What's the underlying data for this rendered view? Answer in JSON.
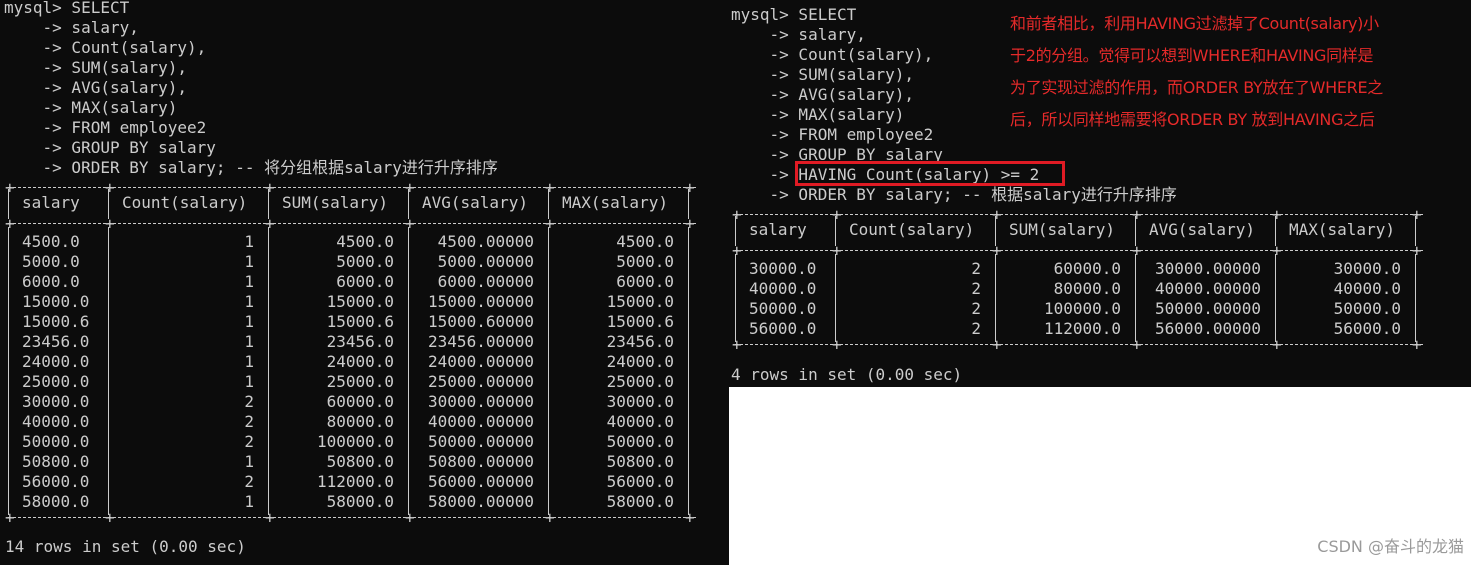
{
  "left": {
    "query": [
      "mysql> SELECT",
      "    -> salary,",
      "    -> Count(salary),",
      "    -> SUM(salary),",
      "    -> AVG(salary),",
      "    -> MAX(salary)",
      "    -> FROM employee2",
      "    -> GROUP BY salary",
      "    -> ORDER BY salary; -- 将分组根据salary进行升序排序"
    ],
    "headers": [
      "salary",
      "Count(salary)",
      "SUM(salary)",
      "AVG(salary)",
      "MAX(salary)"
    ],
    "rows": [
      [
        "4500.0",
        "1",
        "4500.0",
        "4500.00000",
        "4500.0"
      ],
      [
        "5000.0",
        "1",
        "5000.0",
        "5000.00000",
        "5000.0"
      ],
      [
        "6000.0",
        "1",
        "6000.0",
        "6000.00000",
        "6000.0"
      ],
      [
        "15000.0",
        "1",
        "15000.0",
        "15000.00000",
        "15000.0"
      ],
      [
        "15000.6",
        "1",
        "15000.6",
        "15000.60000",
        "15000.6"
      ],
      [
        "23456.0",
        "1",
        "23456.0",
        "23456.00000",
        "23456.0"
      ],
      [
        "24000.0",
        "1",
        "24000.0",
        "24000.00000",
        "24000.0"
      ],
      [
        "25000.0",
        "1",
        "25000.0",
        "25000.00000",
        "25000.0"
      ],
      [
        "30000.0",
        "2",
        "60000.0",
        "30000.00000",
        "30000.0"
      ],
      [
        "40000.0",
        "2",
        "80000.0",
        "40000.00000",
        "40000.0"
      ],
      [
        "50000.0",
        "2",
        "100000.0",
        "50000.00000",
        "50000.0"
      ],
      [
        "50800.0",
        "1",
        "50800.0",
        "50800.00000",
        "50800.0"
      ],
      [
        "56000.0",
        "2",
        "112000.0",
        "56000.00000",
        "56000.0"
      ],
      [
        "58000.0",
        "1",
        "58000.0",
        "58000.00000",
        "58000.0"
      ]
    ],
    "footer": "14 rows in set (0.00 sec)"
  },
  "right": {
    "query": [
      "mysql> SELECT",
      "    -> salary,",
      "    -> Count(salary),",
      "    -> SUM(salary),",
      "    -> AVG(salary),",
      "    -> MAX(salary)",
      "    -> FROM employee2",
      "    -> GROUP BY salary",
      "    -> HAVING Count(salary) >= 2",
      "    -> ORDER BY salary; -- 根据salary进行升序排序"
    ],
    "headers": [
      "salary",
      "Count(salary)",
      "SUM(salary)",
      "AVG(salary)",
      "MAX(salary)"
    ],
    "rows": [
      [
        "30000.0",
        "2",
        "60000.0",
        "30000.00000",
        "30000.0"
      ],
      [
        "40000.0",
        "2",
        "80000.0",
        "40000.00000",
        "40000.0"
      ],
      [
        "50000.0",
        "2",
        "100000.0",
        "50000.00000",
        "50000.0"
      ],
      [
        "56000.0",
        "2",
        "112000.0",
        "56000.00000",
        "56000.0"
      ]
    ],
    "footer": "4 rows in set (0.00 sec)"
  },
  "annotation": {
    "lines": [
      "和前者相比，利用HAVING过滤掉了Count(salary)小",
      "于2的分组。觉得可以想到WHERE和HAVING同样是",
      "为了实现过滤的作用，而ORDER BY放在了WHERE之",
      "后，所以同样地需要将ORDER BY 放到HAVING之后"
    ],
    "color": "#e52a2a",
    "highlight_color": "#e01b24"
  },
  "watermark": "CSDN @奋斗的龙猫"
}
